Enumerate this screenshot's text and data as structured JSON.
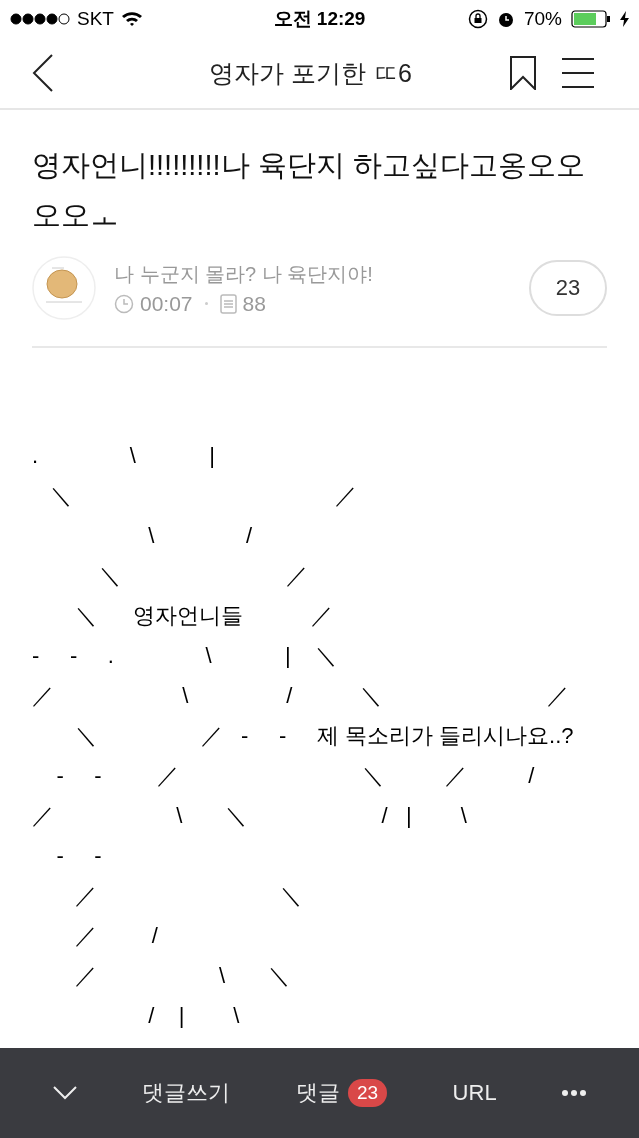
{
  "status_bar": {
    "carrier": "SKT",
    "time": "오전 12:29",
    "battery": "70%"
  },
  "nav": {
    "title": "영자가 포기한 ㄸ6"
  },
  "post": {
    "title": "영자언니!!!!!!!!!나 육단지 하고싶다고옹오오오오ㅗ",
    "author": "나 누군지 몰라? 나 육단지야!",
    "time": "00:07",
    "views": "88",
    "comment_count": "23"
  },
  "art_lines": [
    ".               \\            |",
    "   ＼                                           ／",
    "                   \\               /",
    "           ＼                           ／",
    "       ＼      영자언니들           ／",
    "-     -     .               \\            |    ＼",
    "／                     \\                /           ＼                           ／",
    "       ＼                 ／   -     -     제 목소리가 들리시나요..?",
    "    -     -         ／                              ＼          ／          /",
    "／                    \\       ＼                      /   |        \\",
    "    -     -",
    "       ／                              ＼",
    "       ／         /",
    "       ／                    \\       ＼",
    "                   /    |        \\"
  ],
  "bottom_bar": {
    "items": [
      {
        "kind": "collapse"
      },
      {
        "kind": "text",
        "label": "댓글쓰기"
      },
      {
        "kind": "badge",
        "label": "댓글",
        "badge": "23"
      },
      {
        "kind": "text",
        "label": "URL"
      },
      {
        "kind": "more"
      }
    ]
  }
}
